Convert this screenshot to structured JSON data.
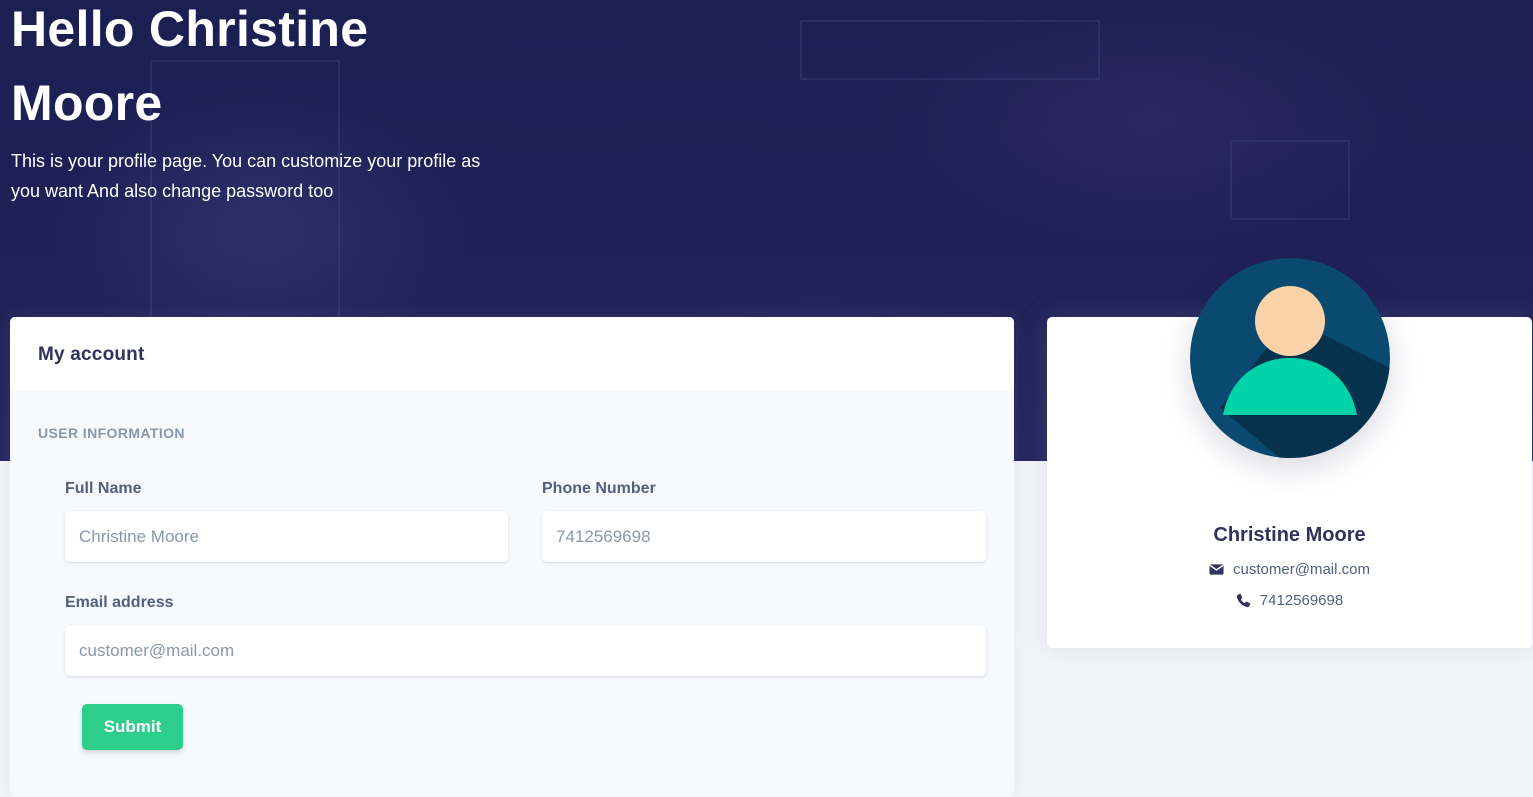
{
  "hero": {
    "title": "Hello Christine Moore",
    "description": "This is your profile page. You can customize your profile as you want And also change password too"
  },
  "account": {
    "title": "My account",
    "section": "USER INFORMATION",
    "full_name": {
      "label": "Full Name",
      "placeholder": "Christine Moore"
    },
    "phone": {
      "label": "Phone Number",
      "placeholder": "7412569698"
    },
    "email": {
      "label": "Email address",
      "placeholder": "customer@mail.com"
    },
    "submit_label": "Submit"
  },
  "profile": {
    "name": "Christine Moore",
    "email": "customer@mail.com",
    "phone": "7412569698",
    "email_icon": "envelope-icon",
    "phone_icon": "phone-icon"
  },
  "colors": {
    "hero_bg": "#1f2157",
    "primary_text": "#32325d",
    "label_text": "#525f7f",
    "muted_text": "#8898aa",
    "success": "#2dce89",
    "avatar_bg": "#0b4a70",
    "avatar_skin": "#fcd3a8",
    "avatar_body": "#00d3a7"
  }
}
